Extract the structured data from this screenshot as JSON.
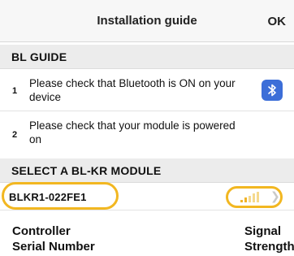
{
  "header": {
    "title": "Installation guide",
    "ok_label": "OK"
  },
  "guide": {
    "section_title": "BL GUIDE",
    "steps": [
      {
        "number": "1",
        "text": "Please check that Bluetooth is ON on your device"
      },
      {
        "number": "2",
        "text": "Please check that your module is powered on"
      }
    ],
    "bluetooth_icon": "bluetooth-icon"
  },
  "modules": {
    "section_title": "SELECT A BL-KR MODULE",
    "items": [
      {
        "name": "BLKR1-022FE1",
        "signal_level": 2,
        "signal_bars": 5
      }
    ]
  },
  "annotations": {
    "left_line1": "Controller",
    "left_line2": "Serial Number",
    "right_line1": "Signal",
    "right_line2": "Strength"
  },
  "colors": {
    "highlight": "#f2b721",
    "signal_active": "#f0b32a",
    "signal_inactive": "#f5d98e",
    "bluetooth_button": "#3c6ed8"
  }
}
